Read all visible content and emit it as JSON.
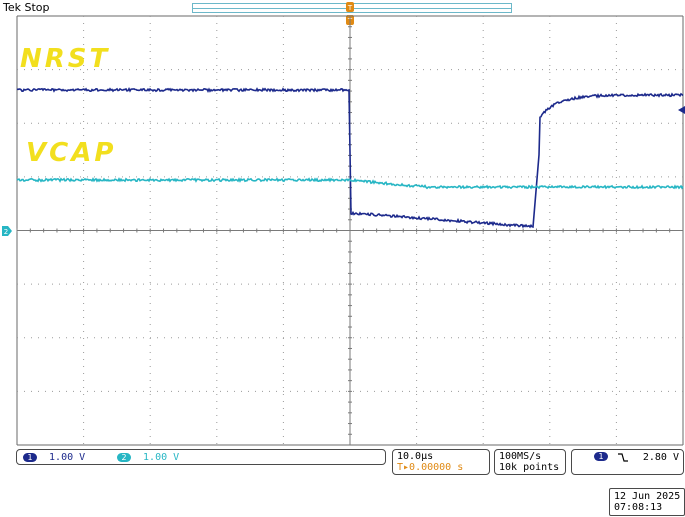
{
  "status": {
    "brand": "Tek",
    "state": "Stop"
  },
  "labels": {
    "nrst": "NRST",
    "vcap": "VCAP"
  },
  "channels": [
    {
      "number": "1",
      "scale": "1.00 V",
      "color": "#1d2a8c"
    },
    {
      "number": "2",
      "scale": "1.00 V",
      "color": "#27b6c4"
    }
  ],
  "timebase": {
    "per_div": "10.0µs",
    "position": "0.00000 s"
  },
  "acquisition": {
    "rate": "100MS/s",
    "points": "10k points"
  },
  "trigger": {
    "source": "1",
    "slope_icon": "falling-edge-icon",
    "level": "2.80 V"
  },
  "datetime": {
    "date": "12 Jun 2025",
    "time": "07:08:13"
  },
  "colors": {
    "label_yellow": "#f2df1e",
    "trigger_orange": "#e08a14",
    "ch1": "#1d2a8c",
    "ch2": "#27b6c4"
  }
}
